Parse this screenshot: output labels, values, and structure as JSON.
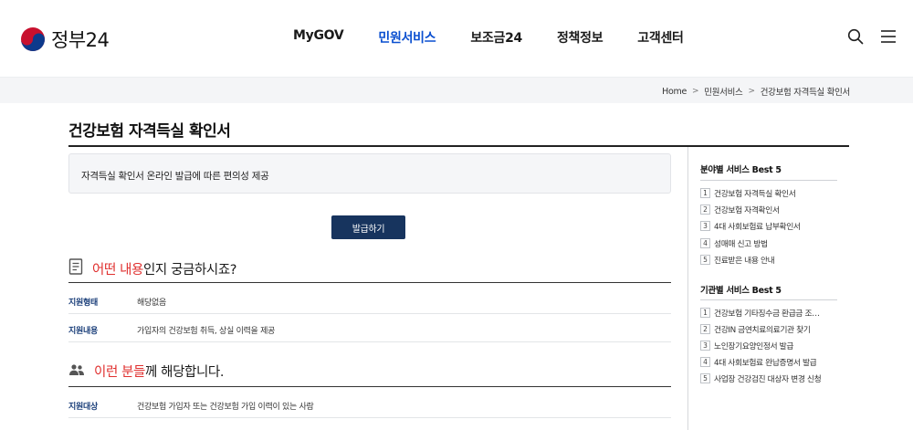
{
  "header": {
    "logo_text": "정부",
    "logo_num": "24",
    "nav": [
      "MyGOV",
      "민원서비스",
      "보조금24",
      "정책정보",
      "고객센터"
    ],
    "active_nav": "민원서비스"
  },
  "breadcrumb": [
    "Home",
    "민원서비스",
    "건강보험 자격득실 확인서"
  ],
  "page": {
    "title": "건강보험 자격득실 확인서",
    "summary": "자격득실 확인서 온라인 발급에 따른 편의성 제공",
    "issue_button": "발급하기"
  },
  "section1": {
    "highlight": "어떤 내용",
    "rest": "인지 궁금하시죠?",
    "rows": [
      {
        "key": "지원형태",
        "value": "해당없음"
      },
      {
        "key": "지원내용",
        "value": "가입자의 건강보험 취득, 상실 이력을 제공"
      }
    ]
  },
  "section2": {
    "highlight": "이런 분들",
    "rest": "께 해당합니다.",
    "rows": [
      {
        "key": "지원대상",
        "value": "건강보험 가입자 또는 건강보험 가입 이력이 있는 사람"
      }
    ]
  },
  "sidebar": {
    "best_field": {
      "title": "분야별 서비스 Best 5",
      "items": [
        {
          "num": "1",
          "label": "건강보험 자격득실 확인서"
        },
        {
          "num": "2",
          "label": "건강보험 자격확인서"
        },
        {
          "num": "3",
          "label": "4대 사회보험료 납부확인서"
        },
        {
          "num": "4",
          "label": "성매매 신고 방법"
        },
        {
          "num": "5",
          "label": "진료받은 내용 안내"
        }
      ]
    },
    "best_org": {
      "title": "기관별 서비스 Best 5",
      "items": [
        {
          "num": "1",
          "label": "건강보험 기타징수금 환급금 조…"
        },
        {
          "num": "2",
          "label": "건강IN 금연치료의료기관 찾기"
        },
        {
          "num": "3",
          "label": "노인장기요양인정서 발급"
        },
        {
          "num": "4",
          "label": "4대 사회보험료 완납증명서 발급"
        },
        {
          "num": "5",
          "label": "사업장 건강검진 대상자 변경 신청"
        }
      ]
    }
  },
  "colors": {
    "accent_blue": "#0b50d0",
    "button_navy": "#17345e",
    "highlight_red": "#e0302f",
    "key_blue": "#1b3f7a"
  }
}
